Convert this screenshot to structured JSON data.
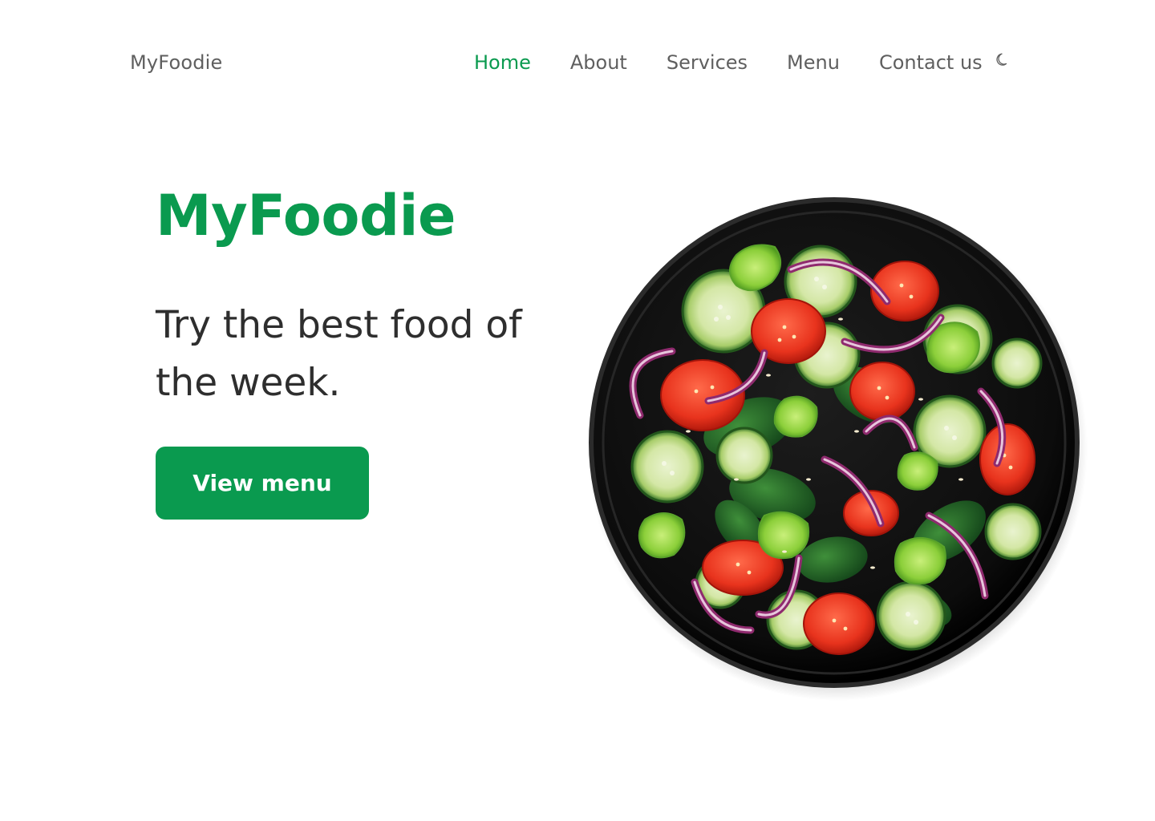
{
  "header": {
    "logo": "MyFoodie",
    "nav": [
      "Home",
      "About",
      "Services",
      "Menu",
      "Contact us"
    ],
    "active_nav": "Home",
    "theme_toggle_icon": "moon-icon"
  },
  "hero": {
    "title": "MyFoodie",
    "subtitle": "Try the best food of the week.",
    "cta_label": "View menu",
    "image_icon": "salad-plate"
  },
  "colors": {
    "accent": "#0a9a4f",
    "nav_text": "#5f5f5f",
    "body_text": "#2e2e2e",
    "background": "#ffffff"
  }
}
